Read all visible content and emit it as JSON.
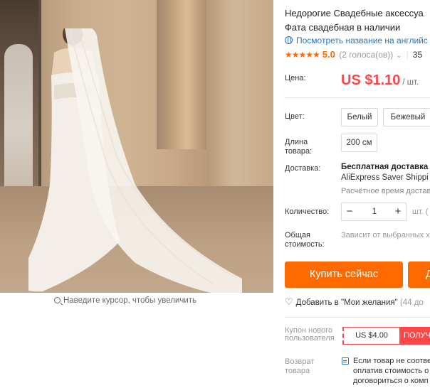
{
  "gallery": {
    "zoom_hint": "Наведите курсор, чтобы увеличить"
  },
  "product": {
    "title_line1": "Недорогие Свадебные аксессуа",
    "title_line2": "Фата свадебная в наличии",
    "translate_link": "Посмотреть название на английс",
    "rating": {
      "stars": "★★★★★",
      "score": "5.0",
      "votes": "(2 голоса(ов))",
      "orders": "35"
    }
  },
  "price": {
    "label": "Цена:",
    "value": "US $1.10",
    "unit": "/ шт."
  },
  "color": {
    "label": "Цвет:",
    "options": [
      "Белый",
      "Бежевый"
    ]
  },
  "length": {
    "label_line1": "Длина",
    "label_line2": "товара:",
    "options": [
      "200 см"
    ]
  },
  "delivery": {
    "label": "Доставка:",
    "title": "Бесплатная доставка в",
    "method": "AliExpress Saver Shippi",
    "estimate": "Расчётное время достав"
  },
  "quantity": {
    "label": "Количество:",
    "minus": "−",
    "value": "1",
    "plus": "+",
    "unit": "шт. ("
  },
  "total": {
    "label_line1": "Общая",
    "label_line2": "стоимость:",
    "value": "Зависит от выбранных х"
  },
  "actions": {
    "buy_now": "Купить сейчас",
    "add_to_cart": "Д"
  },
  "wishlist": {
    "text": "Добавить в \"Мои желания\"",
    "count": "(44 до"
  },
  "coupon": {
    "label": "Купон нового пользователя",
    "amount": "US $4.00",
    "get": "ПОЛУЧ"
  },
  "return": {
    "label_line1": "Возврат",
    "label_line2": "товара",
    "text_line1": "Если товар не соотве",
    "text_line2": "оплатив стоимость о",
    "text_line3": "договориться о комп"
  },
  "colors": {
    "accent": "#ff6a00",
    "price": "#ff4747",
    "link": "#2b73c4"
  }
}
